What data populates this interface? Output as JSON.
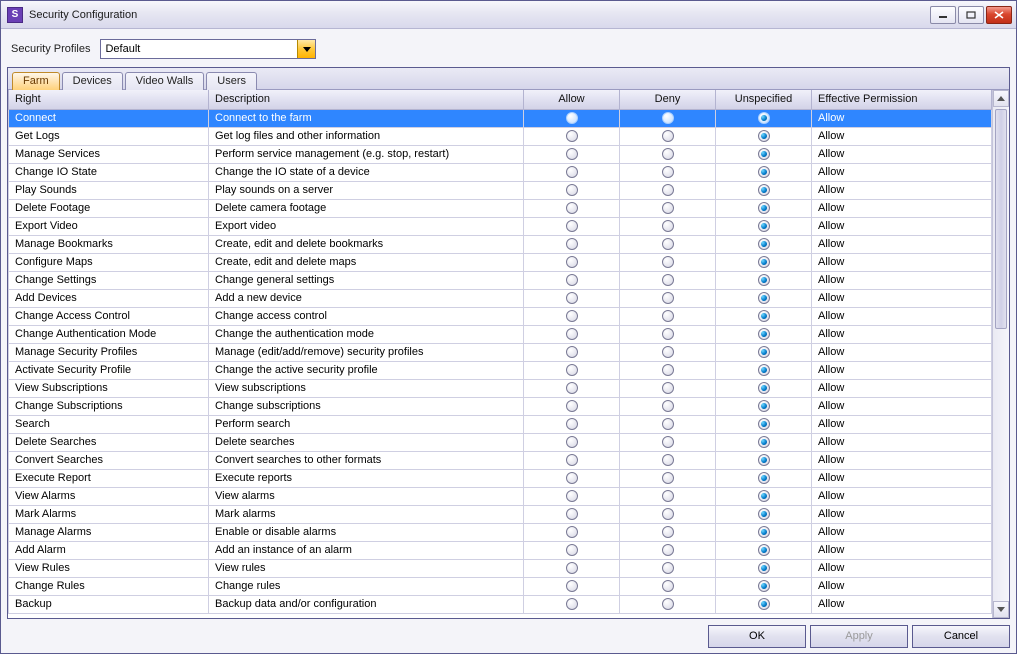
{
  "window": {
    "title": "Security Configuration",
    "app_icon_letter": "S"
  },
  "profile": {
    "label": "Security Profiles",
    "value": "Default"
  },
  "tabs": [
    {
      "id": "farm",
      "label": "Farm",
      "active": true
    },
    {
      "id": "devices",
      "label": "Devices",
      "active": false
    },
    {
      "id": "video-walls",
      "label": "Video Walls",
      "active": false
    },
    {
      "id": "users",
      "label": "Users",
      "active": false
    }
  ],
  "columns": {
    "right": "Right",
    "description": "Description",
    "allow": "Allow",
    "deny": "Deny",
    "unspecified": "Unspecified",
    "effective": "Effective Permission"
  },
  "rows": [
    {
      "right": "Connect",
      "description": "Connect to the farm",
      "state": "unspecified",
      "effective": "Allow",
      "selected": true
    },
    {
      "right": "Get Logs",
      "description": "Get log files and other information",
      "state": "unspecified",
      "effective": "Allow"
    },
    {
      "right": "Manage Services",
      "description": "Perform service management (e.g. stop, restart)",
      "state": "unspecified",
      "effective": "Allow"
    },
    {
      "right": "Change IO State",
      "description": "Change the IO state of a device",
      "state": "unspecified",
      "effective": "Allow"
    },
    {
      "right": "Play Sounds",
      "description": "Play sounds on a server",
      "state": "unspecified",
      "effective": "Allow"
    },
    {
      "right": "Delete Footage",
      "description": "Delete camera footage",
      "state": "unspecified",
      "effective": "Allow"
    },
    {
      "right": "Export Video",
      "description": "Export video",
      "state": "unspecified",
      "effective": "Allow"
    },
    {
      "right": "Manage Bookmarks",
      "description": "Create, edit and delete bookmarks",
      "state": "unspecified",
      "effective": "Allow"
    },
    {
      "right": "Configure Maps",
      "description": "Create, edit and delete maps",
      "state": "unspecified",
      "effective": "Allow"
    },
    {
      "right": "Change Settings",
      "description": "Change general settings",
      "state": "unspecified",
      "effective": "Allow"
    },
    {
      "right": "Add Devices",
      "description": "Add a new device",
      "state": "unspecified",
      "effective": "Allow"
    },
    {
      "right": "Change Access Control",
      "description": "Change access control",
      "state": "unspecified",
      "effective": "Allow"
    },
    {
      "right": "Change Authentication Mode",
      "description": "Change the authentication mode",
      "state": "unspecified",
      "effective": "Allow"
    },
    {
      "right": "Manage Security Profiles",
      "description": "Manage (edit/add/remove) security profiles",
      "state": "unspecified",
      "effective": "Allow"
    },
    {
      "right": "Activate Security Profile",
      "description": "Change the active security profile",
      "state": "unspecified",
      "effective": "Allow"
    },
    {
      "right": "View Subscriptions",
      "description": "View subscriptions",
      "state": "unspecified",
      "effective": "Allow"
    },
    {
      "right": "Change Subscriptions",
      "description": "Change subscriptions",
      "state": "unspecified",
      "effective": "Allow"
    },
    {
      "right": "Search",
      "description": "Perform search",
      "state": "unspecified",
      "effective": "Allow"
    },
    {
      "right": "Delete Searches",
      "description": "Delete searches",
      "state": "unspecified",
      "effective": "Allow"
    },
    {
      "right": "Convert Searches",
      "description": "Convert searches to other formats",
      "state": "unspecified",
      "effective": "Allow"
    },
    {
      "right": "Execute Report",
      "description": "Execute reports",
      "state": "unspecified",
      "effective": "Allow"
    },
    {
      "right": "View Alarms",
      "description": "View alarms",
      "state": "unspecified",
      "effective": "Allow"
    },
    {
      "right": "Mark Alarms",
      "description": "Mark alarms",
      "state": "unspecified",
      "effective": "Allow"
    },
    {
      "right": "Manage Alarms",
      "description": "Enable or disable alarms",
      "state": "unspecified",
      "effective": "Allow"
    },
    {
      "right": "Add Alarm",
      "description": "Add an instance of an alarm",
      "state": "unspecified",
      "effective": "Allow"
    },
    {
      "right": "View Rules",
      "description": "View rules",
      "state": "unspecified",
      "effective": "Allow"
    },
    {
      "right": "Change Rules",
      "description": "Change rules",
      "state": "unspecified",
      "effective": "Allow"
    },
    {
      "right": "Backup",
      "description": "Backup data and/or configuration",
      "state": "unspecified",
      "effective": "Allow"
    }
  ],
  "buttons": {
    "ok": "OK",
    "apply": "Apply",
    "cancel": "Cancel"
  }
}
